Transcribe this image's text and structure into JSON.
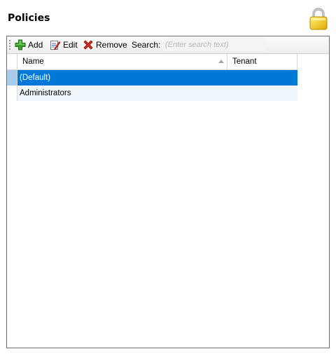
{
  "page": {
    "title": "Policies"
  },
  "icons": {
    "lock": "lock-icon",
    "add": "add-icon",
    "edit": "edit-icon",
    "remove": "remove-icon"
  },
  "toolbar": {
    "add_label": "Add",
    "edit_label": "Edit",
    "remove_label": "Remove",
    "search_label": "Search:",
    "search_value": "",
    "search_placeholder": "(Enter search text)"
  },
  "grid": {
    "columns": [
      {
        "label": "Name",
        "sorted": "ascending"
      },
      {
        "label": "Tenant"
      }
    ],
    "rows": [
      {
        "name": "(Default)",
        "tenant": "",
        "selected": true
      },
      {
        "name": "Administrators",
        "tenant": "",
        "selected": false
      }
    ]
  },
  "colors": {
    "selection": "#0078d7",
    "alt_row": "#eef6fc",
    "add_green": "#3aa52a",
    "remove_red": "#d9261c",
    "lock_gold": "#f2c200"
  }
}
